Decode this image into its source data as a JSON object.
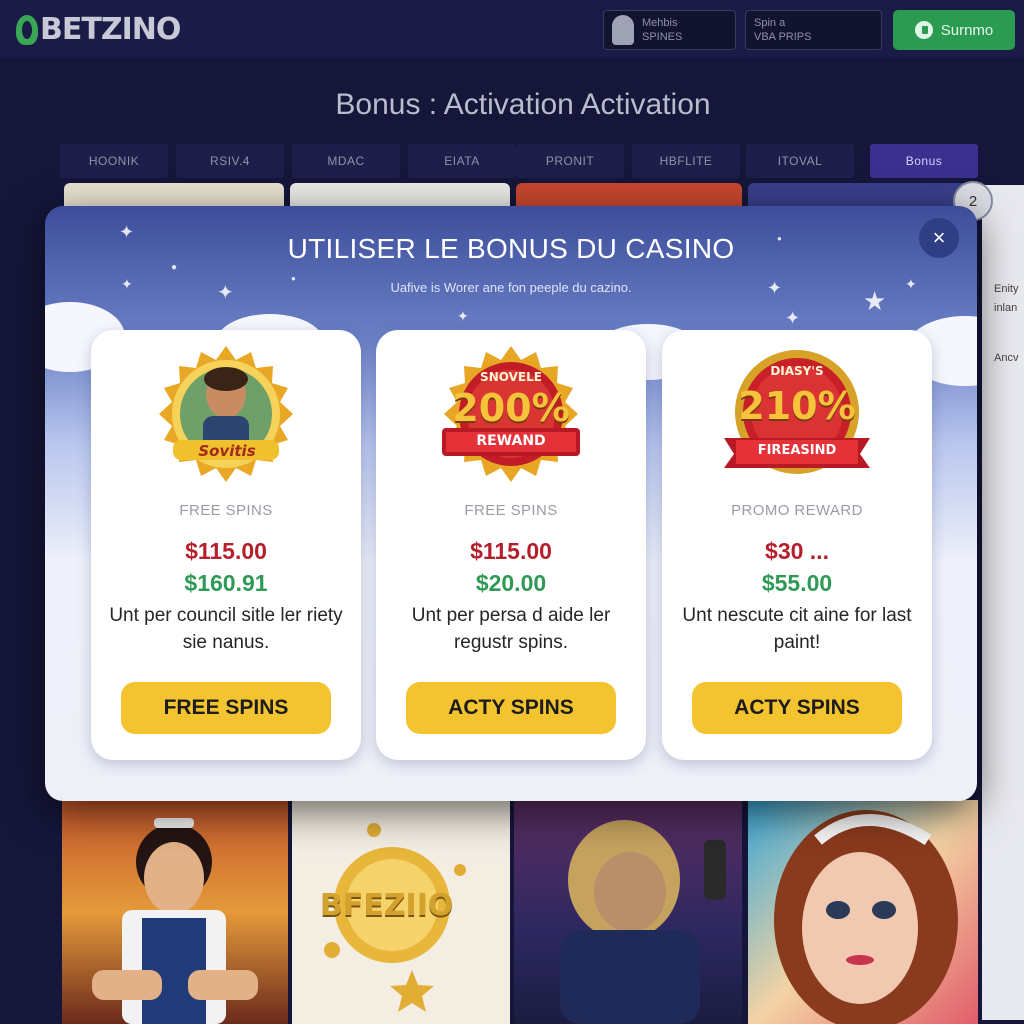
{
  "header": {
    "logo_text": "BETZINO",
    "account_box_line1": "Mehbis",
    "account_box_line2": "SPINES",
    "spin_box_line1": "Spin a",
    "spin_box_line2": "VBA PRIPS",
    "signin_label": "Surnmo"
  },
  "page": {
    "title": "Bonus : Activation Activation",
    "categories": [
      "HOONIK",
      "RSIV.4",
      "MDAC",
      "EIATA",
      "PRONIT",
      "HBFLITE",
      "ITOVAL",
      "Bonus"
    ],
    "active_category": "Bonus",
    "side_badge": "2",
    "side_text1": "Enity",
    "side_text2": "inlan",
    "side_text3": "Ancv",
    "game_tile_label": "BFEZIIO"
  },
  "modal": {
    "title": "UTILISER LE BONUS DU CASINO",
    "subtitle": "Uafive is Worer ane fon peeple du cazino.",
    "close_icon": "×",
    "cards": [
      {
        "badge_top": "",
        "badge_main": "",
        "badge_ribbon": "Sovitis",
        "type": "FREE SPINS",
        "amount_red": "$115.00",
        "amount_green": "$160.91",
        "description": "Unt per council sitle ler riety sie nanus.",
        "button": "FREE SPINS"
      },
      {
        "badge_top": "SNOVELE",
        "badge_main": "200%",
        "badge_ribbon": "REWAND",
        "type": "FREE SPINS",
        "amount_red": "$115.00",
        "amount_green": "$20.00",
        "description": "Unt per persa d aide ler regustr spins.",
        "button": "ACTY SPINS"
      },
      {
        "badge_top": "DIASY'S",
        "badge_main": "210%",
        "badge_ribbon": "FIREASIND",
        "type": "PROMO REWARD",
        "amount_red": "$30 ...",
        "amount_green": "$55.00",
        "description": "Unt nescute cit aine for last paint!",
        "button": "ACTY SPINS"
      }
    ]
  },
  "colors": {
    "accent_button": "#f4c430",
    "amount_red": "#b51f2c",
    "amount_green": "#2f9a55",
    "signin_green": "#2c9b52",
    "active_tab": "#3b2f8f"
  }
}
